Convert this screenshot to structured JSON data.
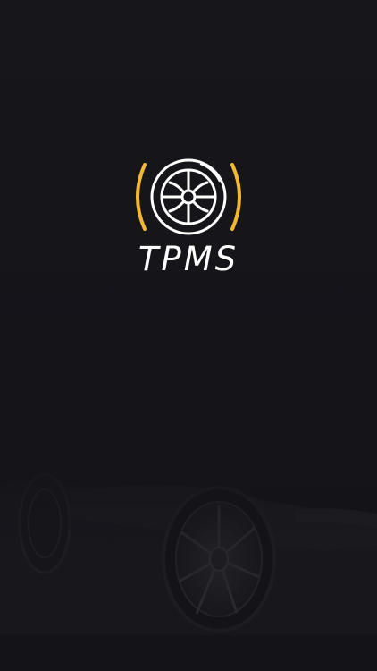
{
  "app": {
    "title": "TPMS"
  },
  "icons": {
    "logo": "tire-pressure-warning-icon",
    "background": "car-wheel-silhouette"
  },
  "colors": {
    "background": "#15151a",
    "accent": "#f4b82e",
    "title": "#ffffff"
  }
}
